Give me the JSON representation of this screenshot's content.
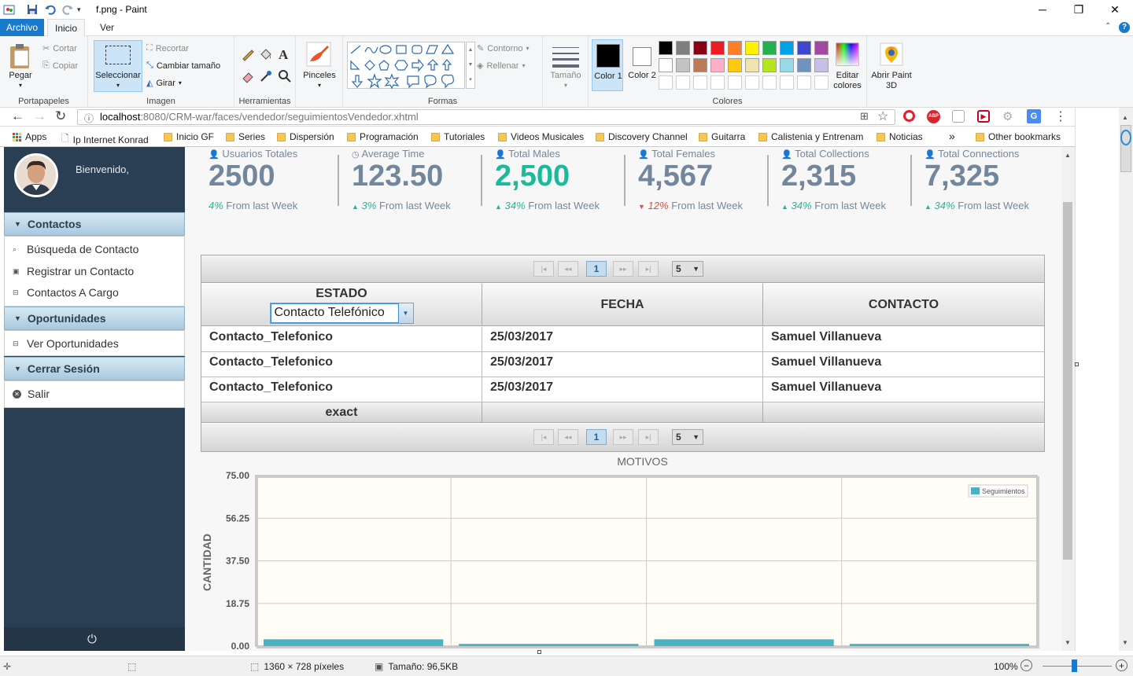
{
  "window": {
    "title": "f.png - Paint"
  },
  "menu_tabs": [
    "Archivo",
    "Inicio",
    "Ver"
  ],
  "ribbon": {
    "portapapeles": {
      "paste": "Pegar",
      "cut": "Cortar",
      "copy": "Copiar",
      "label": "Portapapeles"
    },
    "imagen": {
      "select": "Seleccionar",
      "crop": "Recortar",
      "resize": "Cambiar tamaño",
      "rotate": "Girar",
      "label": "Imagen"
    },
    "herramientas": {
      "label": "Herramientas"
    },
    "pinceles": "Pinceles",
    "formas": {
      "outline": "Contorno",
      "fill": "Rellenar",
      "label": "Formas"
    },
    "tamano": "Tamaño",
    "colores": {
      "color1": "Color 1",
      "color2": "Color 2",
      "edit": "Editar colores",
      "label": "Colores",
      "palette_row1": [
        "#000000",
        "#7f7f7f",
        "#880015",
        "#ed1c24",
        "#ff7f27",
        "#fff200",
        "#22b14c",
        "#00a2e8",
        "#3f48cc",
        "#a349a4"
      ],
      "palette_row2": [
        "#ffffff",
        "#c3c3c3",
        "#b97a57",
        "#ffaec9",
        "#ffc90e",
        "#efe4b0",
        "#b5e61d",
        "#99d9ea",
        "#7092be",
        "#c8bfe7"
      ]
    },
    "paint3d": "Abrir Paint 3D"
  },
  "browser": {
    "url_host": "localhost",
    "url_path": ":8080/CRM-war/faces/vendedor/seguimientosVendedor.xhtml",
    "bookmarks": [
      "Apps",
      "Ip Internet Konrad",
      "Inicio GF",
      "Series",
      "Dispersión",
      "Programación",
      "Tutoriales",
      "Videos Musicales",
      "Discovery Channel",
      "Guitarra",
      "Calistenia y Entrenam",
      "Noticias"
    ],
    "other_bookmarks": "Other bookmarks",
    "more": "»"
  },
  "sidebar": {
    "welcome": "Bienvenido,",
    "sections": [
      {
        "title": "Contactos",
        "items": [
          "Búsqueda de Contacto",
          "Registrar un Contacto",
          "Contactos A Cargo"
        ]
      },
      {
        "title": "Oportunidades",
        "items": [
          "Ver Oportunidades"
        ]
      },
      {
        "title": "Cerrar Sesión",
        "items": [
          "Salir"
        ]
      }
    ]
  },
  "stats": [
    {
      "label": "Usuarios Totales",
      "value": "2500",
      "change": "4%",
      "suffix": "From last Week",
      "trend": "none",
      "highlight": false
    },
    {
      "label": "Average Time",
      "value": "123.50",
      "change": "3%",
      "suffix": "From last Week",
      "trend": "up",
      "highlight": false
    },
    {
      "label": "Total Males",
      "value": "2,500",
      "change": "34%",
      "suffix": "From last Week",
      "trend": "up",
      "highlight": true
    },
    {
      "label": "Total Females",
      "value": "4,567",
      "change": "12%",
      "suffix": "From last Week",
      "trend": "down",
      "highlight": false
    },
    {
      "label": "Total Collections",
      "value": "2,315",
      "change": "34%",
      "suffix": "From last Week",
      "trend": "up",
      "highlight": false
    },
    {
      "label": "Total Connections",
      "value": "7,325",
      "change": "34%",
      "suffix": "From last Week",
      "trend": "up",
      "highlight": false
    }
  ],
  "table": {
    "paginator": {
      "current_page": "1",
      "rows_per_page": "5"
    },
    "columns": [
      "ESTADO",
      "FECHA",
      "CONTACTO"
    ],
    "filter_value": "Contacto Telefónico",
    "rows": [
      [
        "Contacto_Telefonico",
        "25/03/2017",
        "Samuel Villanueva"
      ],
      [
        "Contacto_Telefonico",
        "25/03/2017",
        "Samuel Villanueva"
      ],
      [
        "Contacto_Telefonico",
        "25/03/2017",
        "Samuel Villanueva"
      ]
    ],
    "footer": [
      "exact",
      "",
      ""
    ]
  },
  "chart_data": {
    "type": "bar",
    "title": "MOTIVOS",
    "ylabel": "CANTIDAD",
    "xlabel": "",
    "ylim": [
      0,
      75
    ],
    "yticks": [
      "75.00",
      "56.25",
      "37.50",
      "18.75",
      "0.00"
    ],
    "categories": [
      "",
      "",
      "",
      ""
    ],
    "series": [
      {
        "name": "Seguimientos",
        "values": [
          3,
          1,
          3,
          1
        ]
      }
    ],
    "legend": "top-right",
    "color": "#4bb2c5",
    "background": "#fffdf6",
    "grid": true
  },
  "status": {
    "dimensions": "1360 × 728 píxeles",
    "size": "Tamaño: 96,5KB",
    "zoom": "100%"
  }
}
